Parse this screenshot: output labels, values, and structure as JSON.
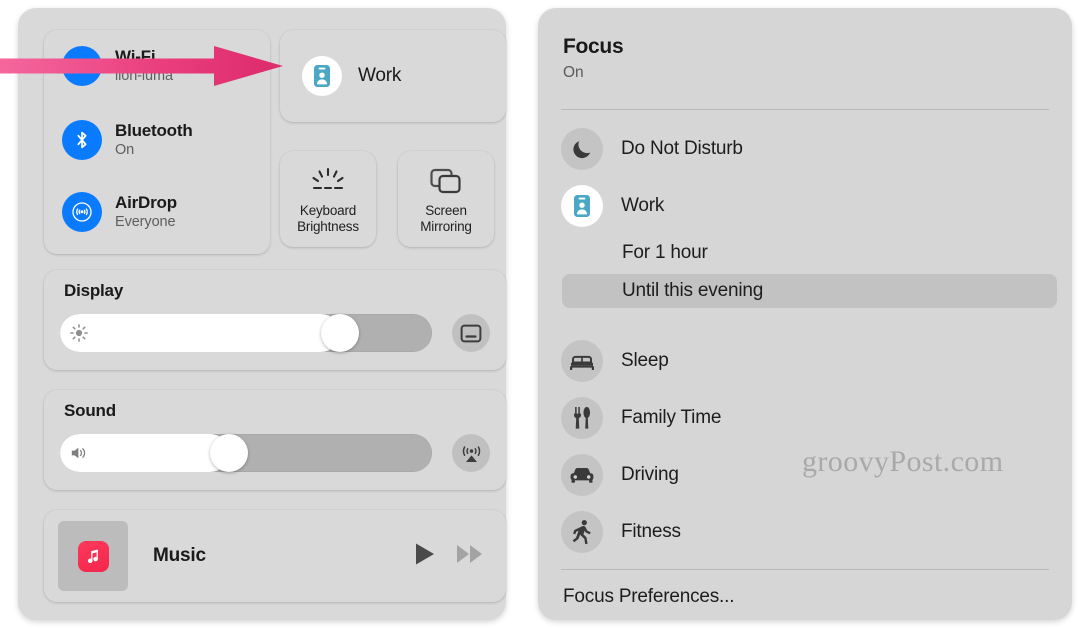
{
  "control_center": {
    "connectivity": [
      {
        "icon": "wifi-icon",
        "title": "Wi-Fi",
        "subtitle": "lion-luma"
      },
      {
        "icon": "bluetooth-icon",
        "title": "Bluetooth",
        "subtitle": "On"
      },
      {
        "icon": "airdrop-icon",
        "title": "AirDrop",
        "subtitle": "Everyone"
      }
    ],
    "focus_tile": {
      "icon": "work-badge-icon",
      "label": "Work"
    },
    "tiles": [
      {
        "icon": "keyboard-brightness-icon",
        "line1": "Keyboard",
        "line2": "Brightness"
      },
      {
        "icon": "screen-mirroring-icon",
        "line1": "Screen",
        "line2": "Mirroring"
      }
    ],
    "display": {
      "label": "Display",
      "icon": "brightness-sun-icon",
      "value_percent": 78,
      "side_button_icon": "display-icon"
    },
    "sound": {
      "label": "Sound",
      "icon": "speaker-icon",
      "value_percent": 45,
      "side_button_icon": "airplay-audio-icon"
    },
    "music": {
      "app_icon": "apple-music-icon",
      "title": "Music",
      "controls": [
        {
          "icon": "play-icon"
        },
        {
          "icon": "fast-forward-icon"
        }
      ]
    }
  },
  "focus_panel": {
    "title": "Focus",
    "status": "On",
    "modes": [
      {
        "icon": "moon-icon",
        "label": "Do Not Disturb",
        "active": false
      },
      {
        "icon": "work-badge-icon",
        "label": "Work",
        "active": true
      },
      {
        "icon": "bed-icon",
        "label": "Sleep",
        "active": false
      },
      {
        "icon": "fork-knife-icon",
        "label": "Family Time",
        "active": false
      },
      {
        "icon": "car-icon",
        "label": "Driving",
        "active": false
      },
      {
        "icon": "runner-icon",
        "label": "Fitness",
        "active": false
      }
    ],
    "duration_options": [
      {
        "label": "For 1 hour",
        "selected": false
      },
      {
        "label": "Until this evening",
        "selected": true
      }
    ],
    "preferences_label": "Focus Preferences..."
  },
  "annotations": {
    "arrow": {
      "name": "pink-arrow-pointer",
      "color_start": "#f4679d",
      "color_end": "#dd2a6b"
    },
    "watermark": "groovyPost.com"
  }
}
